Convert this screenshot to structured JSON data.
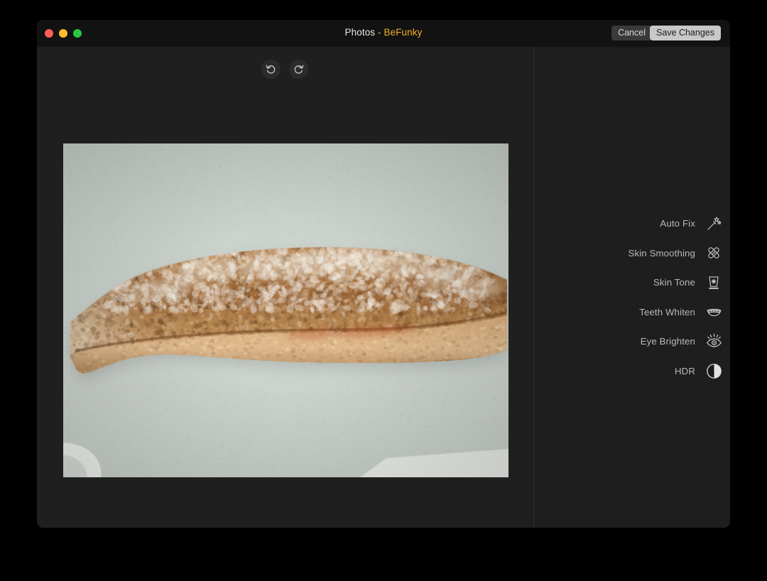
{
  "window": {
    "title_app": "Photos",
    "title_separator": " - ",
    "title_brand": "BeFunky",
    "traffic_lights": {
      "close_color": "#ff5f57",
      "minimize_color": "#febc2e",
      "maximize_color": "#28c840"
    },
    "background_color": "#1f1f1f",
    "titlebar_color": "#121212",
    "brand_accent_color": "#f0b22a"
  },
  "titlebar": {
    "cancel_label": "Cancel",
    "save_label": "Save Changes"
  },
  "history": {
    "undo_icon": "undo-arrow-icon",
    "redo_icon": "redo-arrow-icon"
  },
  "photo": {
    "alt": "Rustic floured baguette loaf on a pale gray-green countertop",
    "subject": "bread loaf",
    "surface_color": "#ccd3cd",
    "crust_color": "#a9713f"
  },
  "tools": {
    "items": [
      {
        "label": "Auto Fix",
        "icon": "magic-wand-icon"
      },
      {
        "label": "Skin Smoothing",
        "icon": "bandage-cross-icon"
      },
      {
        "label": "Skin Tone",
        "icon": "tube-sparkle-icon"
      },
      {
        "label": "Teeth Whiten",
        "icon": "mouth-teeth-icon"
      },
      {
        "label": "Eye Brighten",
        "icon": "eye-rays-icon"
      },
      {
        "label": "HDR",
        "icon": "contrast-circle-icon"
      }
    ]
  }
}
